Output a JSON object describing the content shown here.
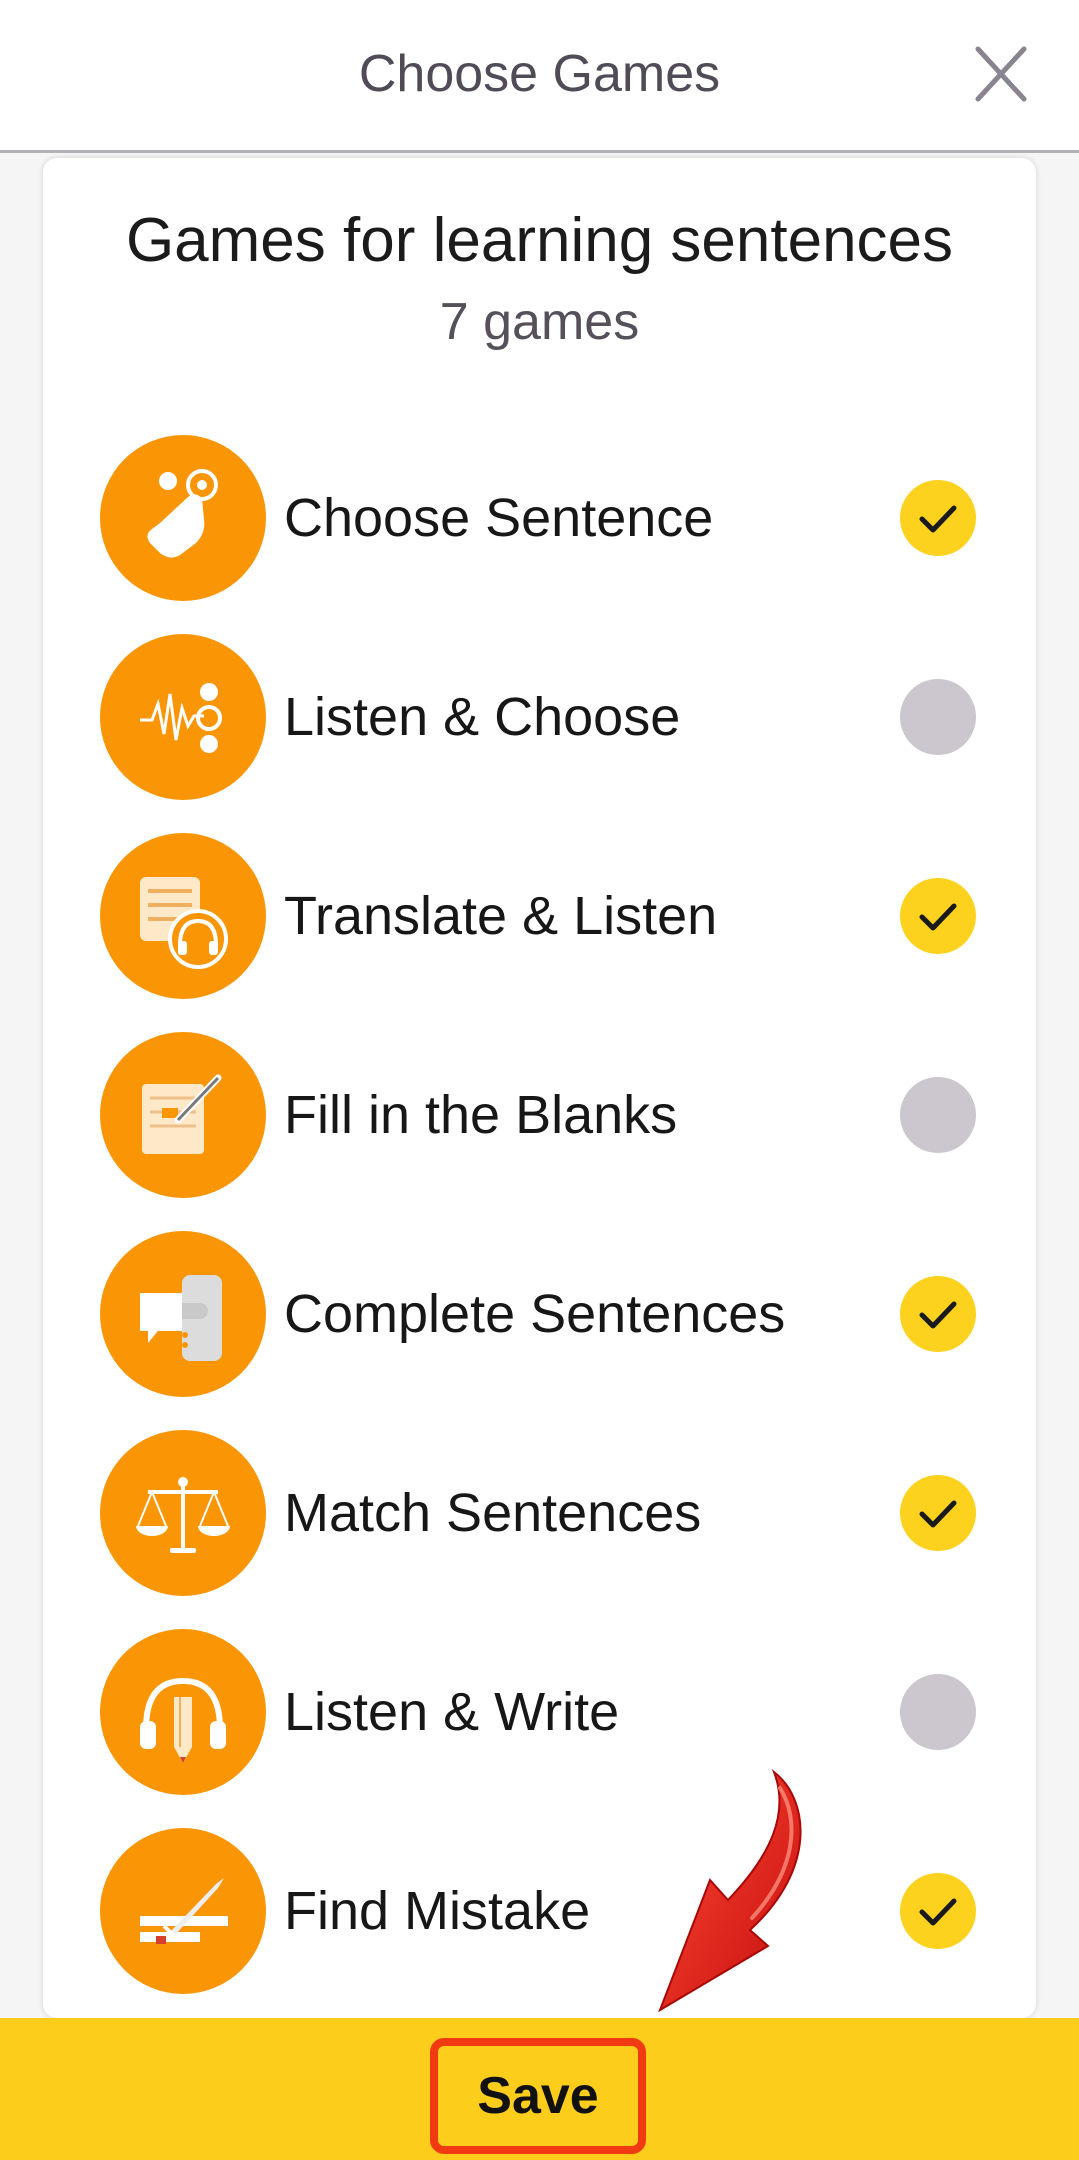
{
  "header": {
    "title": "Choose Games"
  },
  "card": {
    "title": "Games for learning sentences",
    "subtitle": "7 games"
  },
  "games": [
    {
      "label": "Choose Sentence",
      "selected": true,
      "icon": "hand-tap-icon"
    },
    {
      "label": "Listen & Choose",
      "selected": false,
      "icon": "sound-wave-icon"
    },
    {
      "label": "Translate & Listen",
      "selected": true,
      "icon": "list-headphones-icon"
    },
    {
      "label": "Fill in the Blanks",
      "selected": false,
      "icon": "note-pen-icon"
    },
    {
      "label": "Complete Sentences",
      "selected": true,
      "icon": "speech-puzzle-icon"
    },
    {
      "label": "Match Sentences",
      "selected": true,
      "icon": "scales-icon"
    },
    {
      "label": "Listen & Write",
      "selected": false,
      "icon": "headphones-pencil-icon"
    },
    {
      "label": "Find Mistake",
      "selected": true,
      "icon": "sword-bars-icon"
    }
  ],
  "footer": {
    "save_label": "Save"
  },
  "colors": {
    "accent_orange": "#fa9505",
    "check_on": "#fcd21f",
    "check_off": "#ccc6cf",
    "bar_yellow": "#fccd1b",
    "highlight_red": "#f23a12"
  }
}
